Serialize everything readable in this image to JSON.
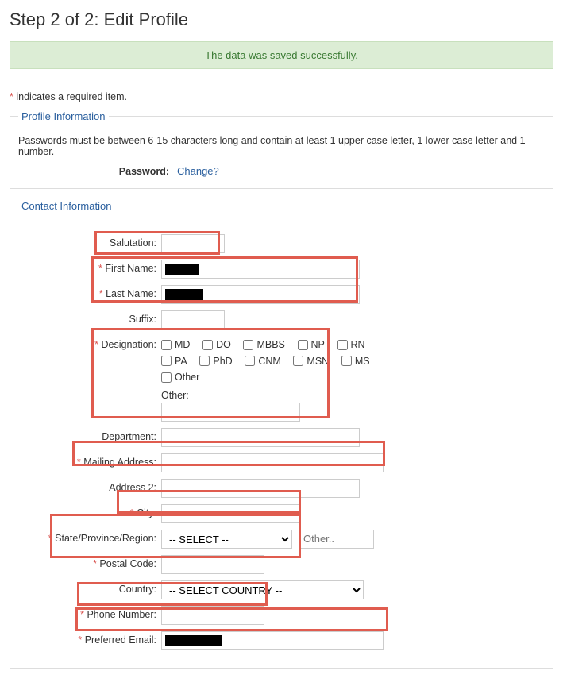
{
  "page_title": "Step 2 of 2: Edit Profile",
  "alert": "The data was saved successfully.",
  "required_note_text": "indicates a required item.",
  "profile": {
    "legend": "Profile Information",
    "password_note": "Passwords must be between 6-15 characters long and contain at least 1 upper case letter, 1 lower case letter and 1 number.",
    "password_label": "Password:",
    "change_link": "Change?"
  },
  "contact": {
    "legend": "Contact Information",
    "salutation_label": "Salutation:",
    "salutation_value": "",
    "first_name_label": "First Name:",
    "first_name_value": "",
    "last_name_label": "Last Name:",
    "last_name_value": "",
    "suffix_label": "Suffix:",
    "suffix_value": "",
    "designation_label": "Designation:",
    "designation_options": [
      "MD",
      "DO",
      "MBBS",
      "NP",
      "RN",
      "PA",
      "PhD",
      "CNM",
      "MSN",
      "MS",
      "Other"
    ],
    "designation_other_label": "Other:",
    "designation_other_value": "",
    "department_label": "Department:",
    "department_value": "",
    "mailing_label": "Mailing Address:",
    "mailing_value": "",
    "address2_label": "Address 2:",
    "address2_value": "",
    "city_label": "City:",
    "city_value": "",
    "state_label": "State/Province/Region:",
    "state_selected": "-- SELECT --",
    "state_other_placeholder": "Other..",
    "state_other_value": "",
    "postal_label": "Postal Code:",
    "postal_value": "",
    "country_label": "Country:",
    "country_selected": "-- SELECT COUNTRY --",
    "phone_label": "Phone Number:",
    "phone_value": "",
    "email_label": "Preferred Email:",
    "email_value": ""
  }
}
